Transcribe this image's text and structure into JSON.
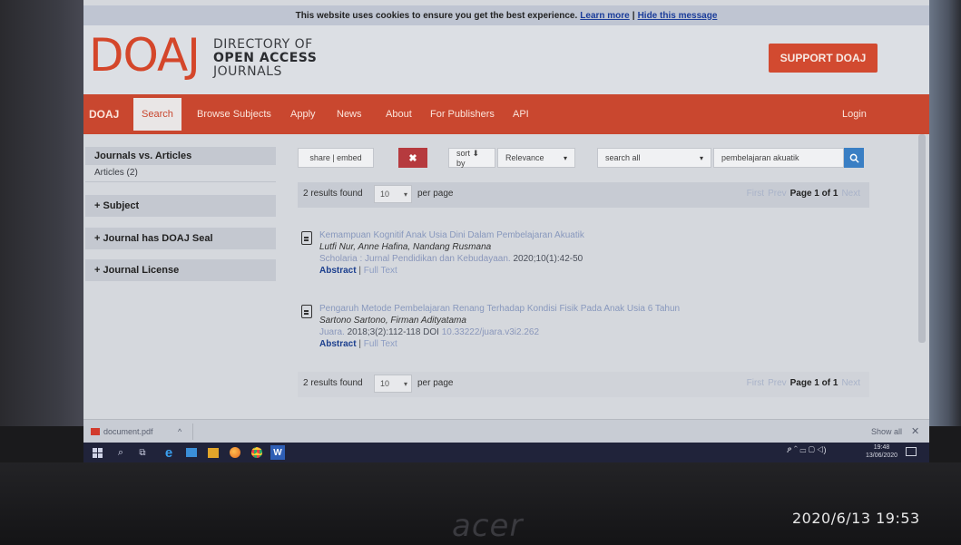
{
  "cookie_bar": {
    "text": "This website uses cookies to ensure you get the best experience.",
    "learn_more": "Learn more",
    "divider": "|",
    "hide": "Hide this message"
  },
  "header": {
    "logo": "DOAJ",
    "logo_line1": "DIRECTORY OF",
    "logo_line2": "OPEN ACCESS",
    "logo_line3": "JOURNALS",
    "support_button": "SUPPORT DOAJ"
  },
  "nav": {
    "items": [
      "DOAJ",
      "Search",
      "Browse Subjects",
      "Apply",
      "News",
      "About",
      "For Publishers",
      "API"
    ],
    "login": "Login"
  },
  "sidebar": {
    "journals_vs_articles": "Journals vs. Articles",
    "articles_count": "Articles (2)",
    "facets": [
      "+ Subject",
      "+ Journal has DOAJ Seal",
      "+ Journal License"
    ]
  },
  "search": {
    "share_embed": "share | embed",
    "clear_icon": "✖",
    "sort_label": "sort ⬇ by",
    "sort_value": "Relevance",
    "field_value": "search all",
    "query": "pembelajaran akuatik",
    "search_icon": "magnifier"
  },
  "results_top": {
    "count": "2 results found",
    "per_page_value": "10",
    "per_page_label": "per page",
    "first": "First",
    "prev": "Prev",
    "page_info": "Page 1 of 1",
    "next": "Next"
  },
  "results_bottom": {
    "count": "2 results found",
    "per_page_value": "10",
    "per_page_label": "per page",
    "first": "First",
    "prev": "Prev",
    "page_info": "Page 1 of 1",
    "next": "Next"
  },
  "results": [
    {
      "title": "Kemampuan Kognitif Anak Usia Dini Dalam Pembelajaran Akuatik",
      "authors": "Lutfi Nur, Anne Hafina, Nandang Rusmana",
      "journal": "Scholaria : Jurnal Pendidikan dan Kebudayaan.",
      "citation": "2020;10(1):42-50",
      "abstract": "Abstract",
      "sep": "|",
      "full_text": "Full Text"
    },
    {
      "title": "Pengaruh Metode Pembelajaran Renang Terhadap Kondisi Fisik Pada Anak Usia 6 Tahun",
      "authors": "Sartono Sartono, Firman Adityatama",
      "journal": "Juara.",
      "citation": "2018;3(2):112-118 DOI",
      "doi": "10.33222/juara.v3i2.262",
      "abstract": "Abstract",
      "sep": "|",
      "full_text": "Full Text"
    }
  ],
  "downloads": {
    "file": "document.pdf",
    "caret": "^",
    "show_all": "Show all",
    "close": "✕"
  },
  "taskbar": {
    "time": "19:48",
    "date": "13/06/2020",
    "word_icon": "W"
  },
  "photo": {
    "brand": "acer",
    "timestamp": "2020/6/13  19:53"
  },
  "colors": {
    "brand_red": "#c9472f",
    "link_blue": "#1c3f8e",
    "search_blue": "#3a7fc4",
    "taskbar": "#20233a"
  }
}
